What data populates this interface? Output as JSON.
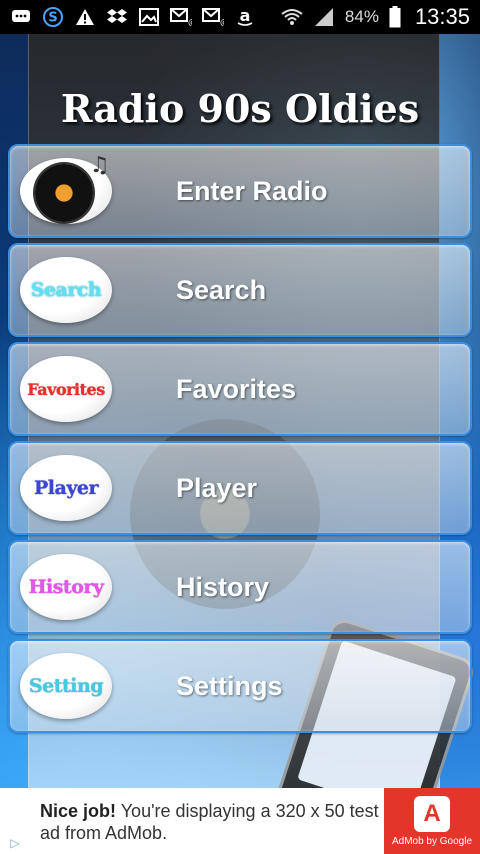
{
  "status_bar": {
    "icons": [
      "message-icon",
      "s-icon",
      "warning-icon",
      "dropbox-icon",
      "image-icon",
      "email-icon",
      "email-icon",
      "amazon-icon",
      "wifi-icon",
      "signal-icon"
    ],
    "battery": "84%",
    "time": "13:35"
  },
  "app": {
    "title": "Radio 90s Oldies"
  },
  "menu": {
    "items": [
      {
        "label": "Enter Radio",
        "badge": "",
        "icon": "vinyl-record-icon"
      },
      {
        "label": "Search",
        "badge": "Search"
      },
      {
        "label": "Favorites",
        "badge": "Favorites"
      },
      {
        "label": "Player",
        "badge": "Player"
      },
      {
        "label": "History",
        "badge": "History"
      },
      {
        "label": "Settings",
        "badge": "Setting"
      }
    ]
  },
  "ad": {
    "headline": "Nice job!",
    "body": "You're displaying a 320 x 50 test ad from AdMob.",
    "brand": "AdMob by Google",
    "colors": {
      "accent": "#e4352a"
    }
  }
}
